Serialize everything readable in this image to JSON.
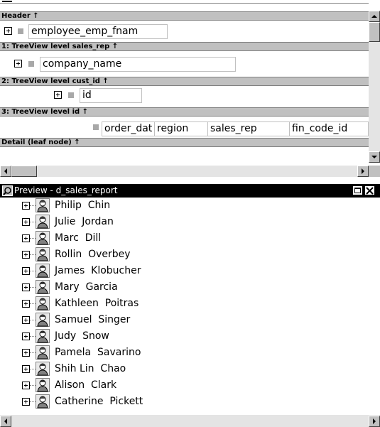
{
  "design": {
    "bands": [
      {
        "label": "Header ↑"
      },
      {
        "label": "1: TreeView level sales_rep ↑"
      },
      {
        "label": "2: TreeView level cust_id ↑"
      },
      {
        "label": "3: TreeView level id ↑"
      },
      {
        "label": "Detail (leaf node) ↑"
      }
    ],
    "fields": {
      "header": "employee_emp_fnam",
      "level1": "company_name",
      "level2": "id",
      "level3": [
        "order_dat",
        "region",
        "sales_rep",
        "fin_code_id"
      ]
    }
  },
  "preview": {
    "title": "Preview - d_sales_report",
    "items": [
      {
        "name": "Philip  Chin"
      },
      {
        "name": "Julie  Jordan"
      },
      {
        "name": "Marc  Dill"
      },
      {
        "name": "Rollin  Overbey"
      },
      {
        "name": "James  Klobucher"
      },
      {
        "name": "Mary  Garcia"
      },
      {
        "name": "Kathleen  Poitras"
      },
      {
        "name": "Samuel  Singer"
      },
      {
        "name": "Judy  Snow"
      },
      {
        "name": "Pamela  Savarino"
      },
      {
        "name": "Shih Lin  Chao"
      },
      {
        "name": "Alison  Clark"
      },
      {
        "name": "Catherine  Pickett"
      }
    ]
  },
  "icons": {
    "expand": "plus-box-icon",
    "employee": "person-icon",
    "window": "preview-window-icon",
    "restore": "restore-icon",
    "close": "close-icon"
  }
}
